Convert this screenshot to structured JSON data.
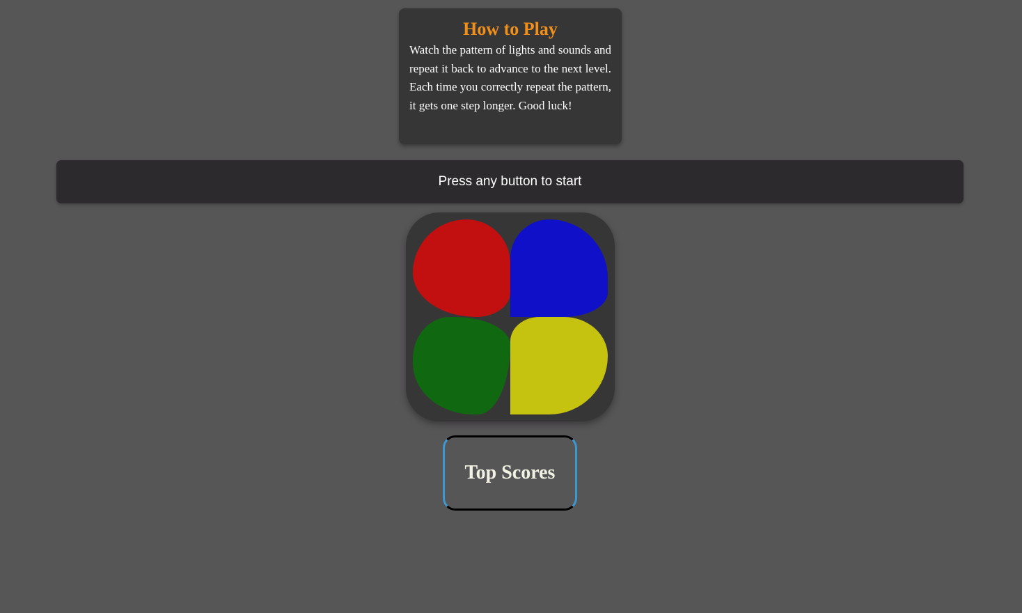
{
  "instructions": {
    "title": "How to Play",
    "text": "Watch the pattern of lights and sounds and repeat it back to advance to the next level. Each time you correctly repeat the pattern, it gets one step longer. Good luck!"
  },
  "status": {
    "message": "Press any button to start"
  },
  "board": {
    "pads": [
      {
        "name": "red",
        "color": "#c21011"
      },
      {
        "name": "blue",
        "color": "#1010c8"
      },
      {
        "name": "green",
        "color": "#106810"
      },
      {
        "name": "yellow",
        "color": "#c6c210"
      }
    ]
  },
  "scores": {
    "button_label": "Top Scores"
  },
  "colors": {
    "background": "#575657",
    "panel": "#373637",
    "status_bar": "#2c2a2c",
    "accent_title": "#f0901a",
    "button_border_accent": "#3c98d2"
  }
}
